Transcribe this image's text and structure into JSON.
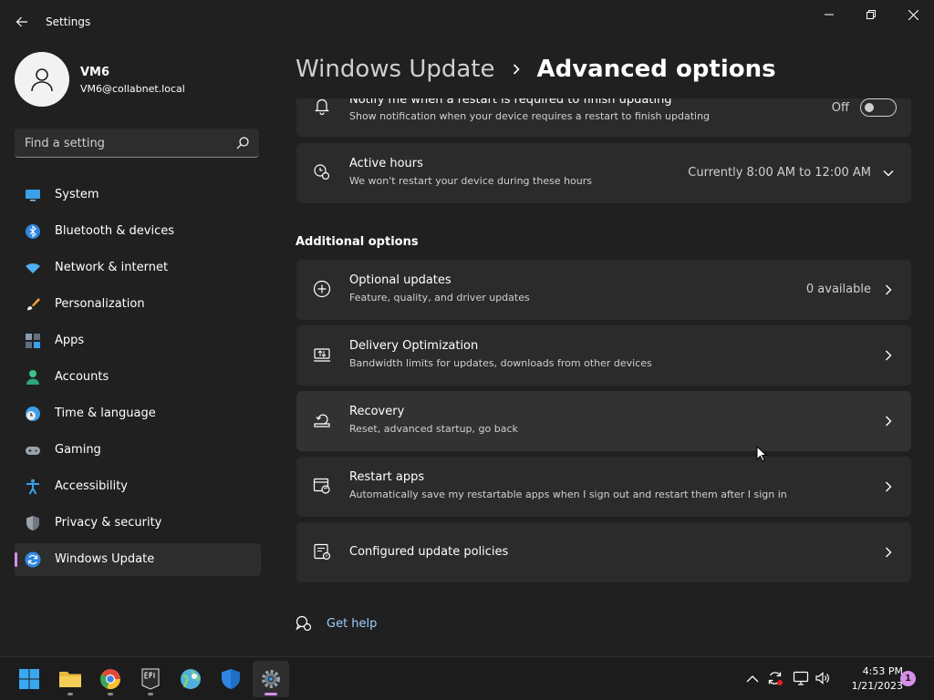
{
  "window": {
    "app_title": "Settings"
  },
  "profile": {
    "name": "VM6",
    "email": "VM6@collabnet.local"
  },
  "search": {
    "placeholder": "Find a setting"
  },
  "sidebar": {
    "items": [
      {
        "label": "System",
        "icon": "monitor-icon"
      },
      {
        "label": "Bluetooth & devices",
        "icon": "bluetooth-icon"
      },
      {
        "label": "Network & internet",
        "icon": "wifi-icon"
      },
      {
        "label": "Personalization",
        "icon": "brush-icon"
      },
      {
        "label": "Apps",
        "icon": "apps-icon"
      },
      {
        "label": "Accounts",
        "icon": "person-icon"
      },
      {
        "label": "Time & language",
        "icon": "clock-globe-icon"
      },
      {
        "label": "Gaming",
        "icon": "gamepad-icon"
      },
      {
        "label": "Accessibility",
        "icon": "accessibility-icon"
      },
      {
        "label": "Privacy & security",
        "icon": "shield-icon"
      },
      {
        "label": "Windows Update",
        "icon": "update-icon",
        "active": true
      }
    ]
  },
  "breadcrumb": {
    "parent": "Windows Update",
    "current": "Advanced options"
  },
  "settings": {
    "notify_restart": {
      "title": "Notify me when a restart is required to finish updating",
      "subtitle": "Show notification when your device requires a restart to finish updating",
      "toggle_label": "Off"
    },
    "active_hours": {
      "title": "Active hours",
      "subtitle": "We won't restart your device during these hours",
      "value": "Currently 8:00 AM to 12:00 AM"
    }
  },
  "additional": {
    "section_title": "Additional options",
    "items": [
      {
        "title": "Optional updates",
        "subtitle": "Feature, quality, and driver updates",
        "value": "0 available"
      },
      {
        "title": "Delivery Optimization",
        "subtitle": "Bandwidth limits for updates, downloads from other devices",
        "value": ""
      },
      {
        "title": "Recovery",
        "subtitle": "Reset, advanced startup, go back",
        "value": ""
      },
      {
        "title": "Restart apps",
        "subtitle": "Automatically save my restartable apps when I sign out and restart them after I sign in",
        "value": ""
      },
      {
        "title": "Configured update policies",
        "subtitle": "",
        "value": ""
      }
    ]
  },
  "help": {
    "label": "Get help"
  },
  "taskbar": {
    "time": "4:53 PM",
    "date": "1/21/2023",
    "notification_count": "1",
    "apps": [
      "start-icon",
      "file-explorer-icon",
      "chrome-icon",
      "epic-games-icon",
      "maps-icon",
      "defender-icon",
      "settings-icon"
    ]
  },
  "colors": {
    "accent": "#d68fe8",
    "link": "#9ccfff",
    "background": "#202020",
    "card": "#2b2b2b"
  }
}
